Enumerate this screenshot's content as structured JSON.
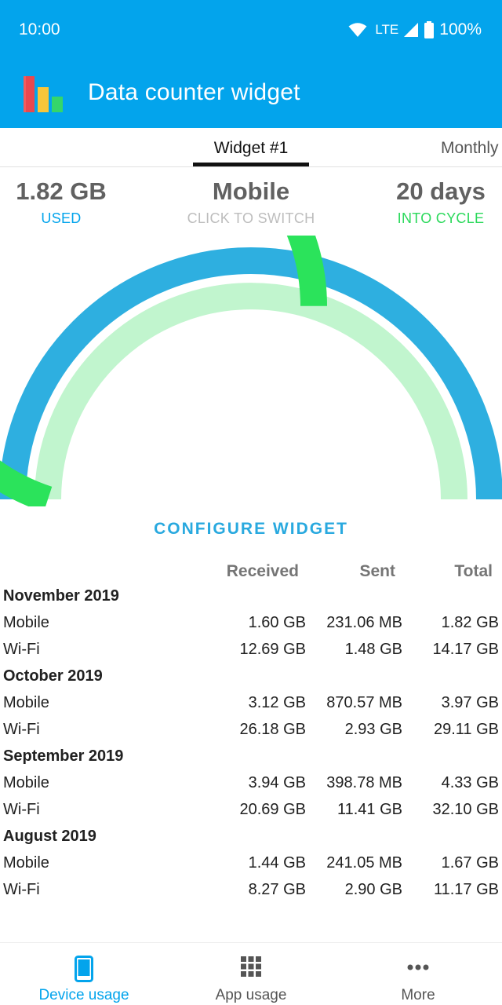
{
  "status_bar": {
    "time": "10:00",
    "network": "LTE",
    "battery": "100%"
  },
  "app": {
    "title": "Data counter widget"
  },
  "tabs": [
    {
      "label": "Widget #1",
      "active": true
    },
    {
      "label": "Monthly",
      "active": false
    }
  ],
  "summary": {
    "used_value": "1.82 GB",
    "used_label": "USED",
    "network_value": "Mobile",
    "network_label": "CLICK TO SWITCH",
    "cycle_value": "20 days",
    "cycle_label": "INTO CYCLE"
  },
  "gauge": {
    "outer_fraction": 1.0,
    "used_fraction": 0.6,
    "colors": {
      "outer": "#2EAFE0",
      "used": "#2BE35B",
      "remaining": "#C1F5CE"
    }
  },
  "configure_label": "CONFIGURE WIDGET",
  "table": {
    "headers": {
      "received": "Received",
      "sent": "Sent",
      "total": "Total"
    },
    "groups": [
      {
        "month": "November 2019",
        "rows": [
          {
            "name": "Mobile",
            "received": "1.60 GB",
            "sent": "231.06 MB",
            "total": "1.82 GB"
          },
          {
            "name": "Wi-Fi",
            "received": "12.69 GB",
            "sent": "1.48 GB",
            "total": "14.17 GB"
          }
        ]
      },
      {
        "month": "October 2019",
        "rows": [
          {
            "name": "Mobile",
            "received": "3.12 GB",
            "sent": "870.57 MB",
            "total": "3.97 GB"
          },
          {
            "name": "Wi-Fi",
            "received": "26.18 GB",
            "sent": "2.93 GB",
            "total": "29.11 GB"
          }
        ]
      },
      {
        "month": "September 2019",
        "rows": [
          {
            "name": "Mobile",
            "received": "3.94 GB",
            "sent": "398.78 MB",
            "total": "4.33 GB"
          },
          {
            "name": "Wi-Fi",
            "received": "20.69 GB",
            "sent": "11.41 GB",
            "total": "32.10 GB"
          }
        ]
      },
      {
        "month": "August 2019",
        "rows": [
          {
            "name": "Mobile",
            "received": "1.44 GB",
            "sent": "241.05 MB",
            "total": "1.67 GB"
          },
          {
            "name": "Wi-Fi",
            "received": "8.27 GB",
            "sent": "2.90 GB",
            "total": "11.17 GB"
          }
        ]
      }
    ]
  },
  "bottom_nav": [
    {
      "label": "Device usage",
      "icon": "phone-icon",
      "active": true
    },
    {
      "label": "App usage",
      "icon": "grid-icon",
      "active": false
    },
    {
      "label": "More",
      "icon": "more-dots-icon",
      "active": false
    }
  ],
  "colors": {
    "accent": "#03A4EC",
    "green": "#2BD95B"
  }
}
